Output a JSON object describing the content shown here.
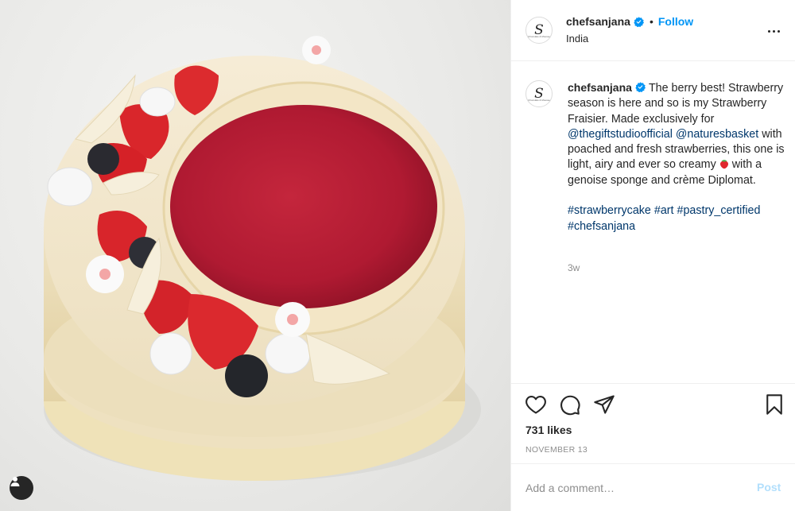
{
  "photo": {
    "alt_icon": "user-silhouette-icon"
  },
  "header": {
    "username": "chefsanjana",
    "separator": "•",
    "follow_label": "Follow",
    "location": "India",
    "more_icon": "more-horizontal-icon",
    "verified_icon": "verified-badge-icon",
    "avatar_monogram": "S",
    "avatar_small_text": "Chocolate & Mousse"
  },
  "caption": {
    "username": "chefsanjana",
    "text_1": "The berry best! Strawberry season is here and so is my Strawberry Fraisier. Made exclusively for",
    "mention_1": "@thegiftstudioofficial",
    "mention_2": "@naturesbasket",
    "text_2": "with poached and fresh strawberries, this one is light, airy and ever so creamy",
    "emoji": "strawberry-emoji",
    "text_3": "with a genoise sponge and crème Diplomat.",
    "tags": [
      "#strawberrycake",
      "#art",
      "#pastry_certified",
      "#chefsanjana"
    ],
    "time_ago": "3w"
  },
  "actions": {
    "like_icon": "heart-icon",
    "comment_icon": "comment-bubble-icon",
    "share_icon": "paper-plane-icon",
    "save_icon": "bookmark-icon",
    "likes": "731 likes",
    "date": "NOVEMBER 13"
  },
  "comment": {
    "placeholder": "Add a comment…",
    "post_label": "Post"
  },
  "colors": {
    "accent": "#0095f6",
    "link": "#00376b",
    "muted": "#8e8e8e",
    "post_disabled": "#b2dffc",
    "border": "#efefef"
  }
}
